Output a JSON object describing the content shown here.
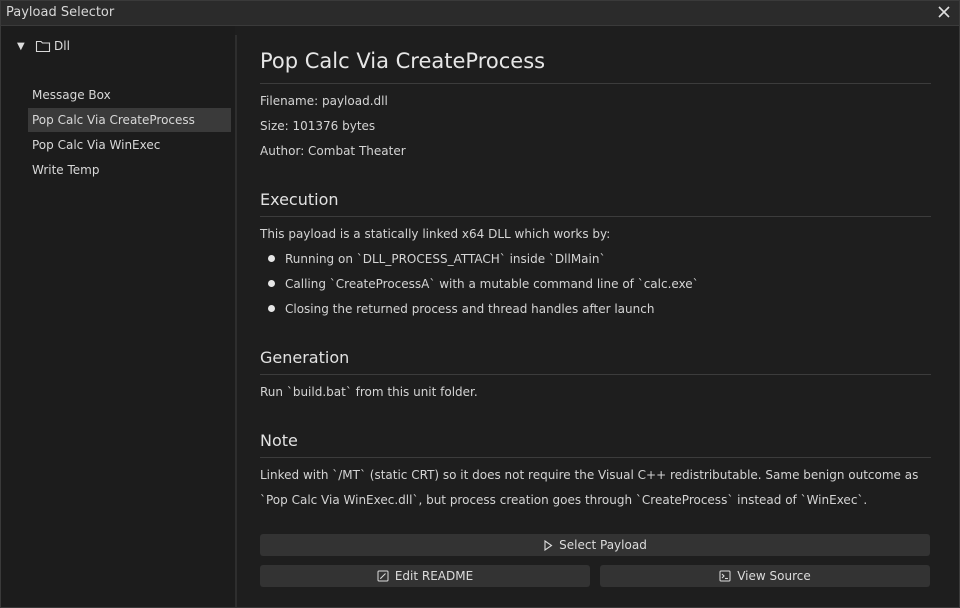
{
  "window": {
    "title": "Payload Selector"
  },
  "tree": {
    "root_label": "Dll",
    "items": [
      {
        "label": "Message Box"
      },
      {
        "label": "Pop Calc Via CreateProcess"
      },
      {
        "label": "Pop Calc Via WinExec"
      },
      {
        "label": "Write Temp"
      }
    ],
    "selected_index": 1
  },
  "detail": {
    "title": "Pop Calc Via CreateProcess",
    "filename": "Filename: payload.dll",
    "size": "Size: 101376 bytes",
    "author": "Author: Combat Theater",
    "execution": {
      "heading": "Execution",
      "intro": "This payload is a statically linked x64 DLL which works by:",
      "bullets": [
        "Running on `DLL_PROCESS_ATTACH` inside `DllMain`",
        "Calling `CreateProcessA` with a mutable command line of `calc.exe`",
        "Closing the returned process and thread handles after launch"
      ]
    },
    "generation": {
      "heading": "Generation",
      "text": "Run `build.bat` from this unit folder."
    },
    "note": {
      "heading": "Note",
      "text": "Linked with `/MT` (static CRT) so it does not require the Visual C++ redistributable. Same benign outcome as `Pop Calc Via WinExec.dll`, but process creation goes through `CreateProcess` instead of `WinExec`."
    }
  },
  "buttons": {
    "select": "Select Payload",
    "edit_readme": "Edit README",
    "view_source": "View Source"
  },
  "icons": {
    "close": "close-icon",
    "folder": "folder-icon",
    "play": "play-icon",
    "edit": "edit-icon",
    "terminal": "terminal-icon"
  },
  "colors": {
    "background": "#1e1e1e",
    "selected_row": "#3a3a3a",
    "button": "#333333"
  }
}
